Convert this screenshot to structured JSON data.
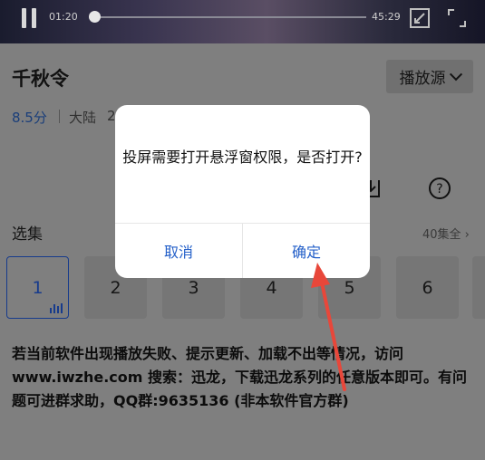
{
  "player": {
    "current_time": "01:20",
    "total_time": "45:29",
    "progress": 0.0
  },
  "show": {
    "title": "千秋令",
    "rating": "8.5分",
    "region": "大陆",
    "year_partial": "2"
  },
  "source_button": {
    "label": "播放源"
  },
  "episodes": {
    "label": "选集",
    "all_label": "40集全 ›",
    "items": [
      "1",
      "2",
      "3",
      "4",
      "5",
      "6"
    ],
    "selected": "1"
  },
  "notice": {
    "text": "若当前软件出现播放失败、提示更新、加载不出等情况，访问www.iwzhe.com 搜索：迅龙，下载迅龙系列的任意版本即可。有问题可进群求助，QQ群:9635136 (非本软件官方群)"
  },
  "dialog": {
    "message": "投屏需要打开悬浮窗权限，是否打开?",
    "cancel_label": "取消",
    "confirm_label": "确定"
  },
  "colors": {
    "accent": "#2460c9",
    "annotation_arrow": "#e8473a",
    "overlay": "#7f7f7f"
  },
  "icons": [
    "pause-icon",
    "fullscreen-exit-icon",
    "fullscreen-icon",
    "chevron-down-icon",
    "download-icon",
    "help-icon",
    "playing-bars-icon"
  ]
}
